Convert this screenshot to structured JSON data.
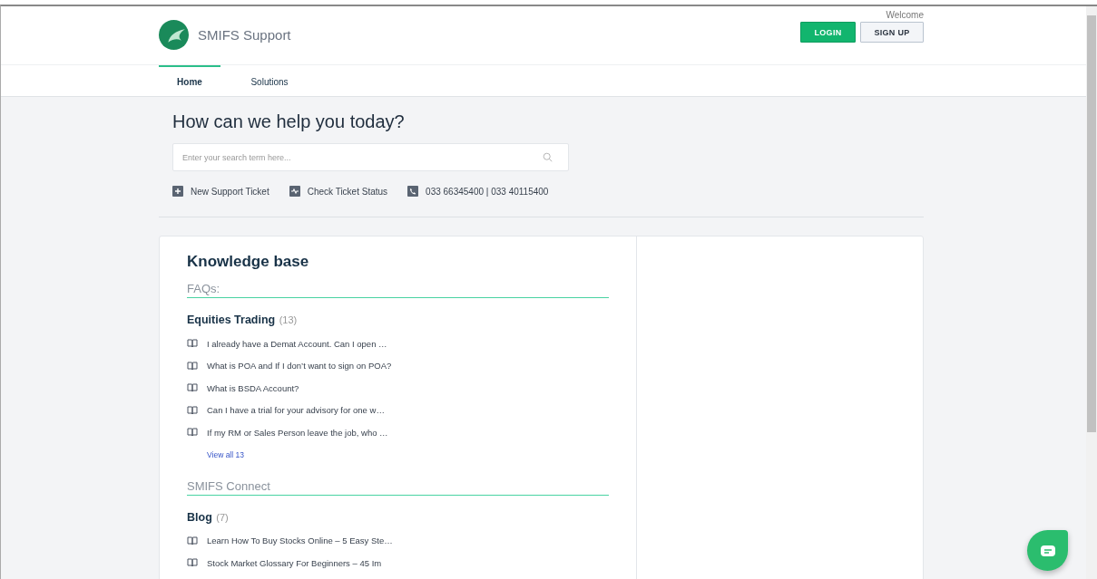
{
  "header": {
    "brand": "SMIFS Support",
    "welcome": "Welcome",
    "login": "LOGIN",
    "signup": "SIGN UP"
  },
  "tabs": [
    {
      "label": "Home",
      "selected": true
    },
    {
      "label": "Solutions",
      "selected": false
    }
  ],
  "hero": {
    "title": "How can we help you today?",
    "search": {
      "placeholder": "Enter your search term here..."
    },
    "links": [
      {
        "kind": "plus",
        "label": "New Support Ticket"
      },
      {
        "kind": "pulse",
        "label": "Check Ticket Status"
      },
      {
        "kind": "phone",
        "label": "033 66345400 | 033 40115400"
      }
    ]
  },
  "knowledge_base": {
    "title": "Knowledge base",
    "sections": [
      {
        "title": "FAQs:",
        "categories": [
          {
            "name": "Equities Trading",
            "count": "(13)",
            "articles": [
              "I already have a Demat Account. Can I open …",
              "What is POA and If I don’t want to sign on POA?",
              "What is BSDA Account?",
              "Can I have a trial for your advisory for one w…",
              "If my RM or Sales Person leave the job, who …"
            ],
            "view_all": "View all 13"
          }
        ]
      },
      {
        "title": "SMIFS Connect",
        "categories": [
          {
            "name": "Blog",
            "count": "(7)",
            "articles": [
              "Learn How To Buy Stocks Online – 5 Easy Ste…",
              "Stock Market Glossary For Beginners – 45 Im"
            ]
          }
        ]
      }
    ]
  }
}
